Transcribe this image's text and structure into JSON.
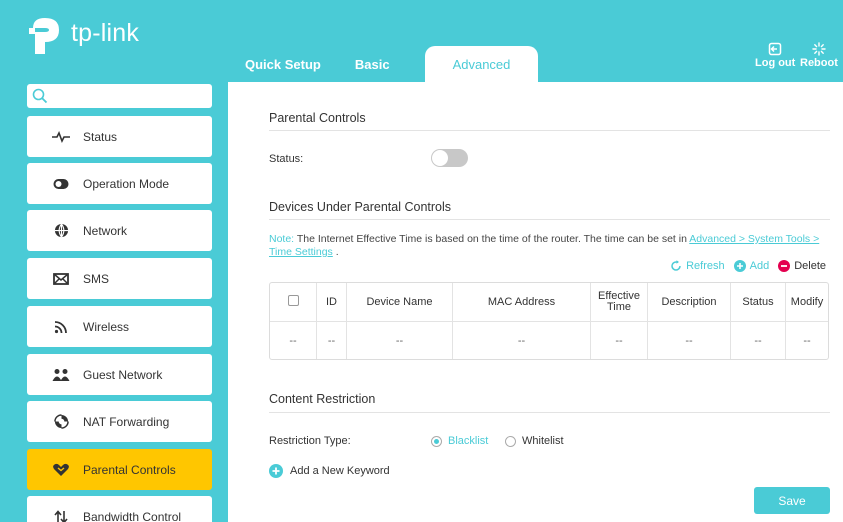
{
  "brand": {
    "logo_text": "tp-link",
    "accent": "#4acbd6",
    "active": "#ffc600"
  },
  "header": {
    "tabs": [
      {
        "label": "Quick Setup"
      },
      {
        "label": "Basic"
      },
      {
        "label": "Advanced"
      }
    ],
    "active_tab": "Advanced",
    "logout_label": "Log out",
    "reboot_label": "Reboot"
  },
  "sidebar": {
    "search_icon": "search-icon",
    "items": [
      {
        "label": "Status",
        "icon": "pulse-icon"
      },
      {
        "label": "Operation Mode",
        "icon": "toggle-icon"
      },
      {
        "label": "Network",
        "icon": "globe-icon"
      },
      {
        "label": "SMS",
        "icon": "envelope-icon"
      },
      {
        "label": "Wireless",
        "icon": "wifi-icon"
      },
      {
        "label": "Guest Network",
        "icon": "guests-icon"
      },
      {
        "label": "NAT Forwarding",
        "icon": "nat-icon"
      },
      {
        "label": "Parental Controls",
        "icon": "heart-shield-icon"
      },
      {
        "label": "Bandwidth Control",
        "icon": "updown-arrows-icon"
      }
    ],
    "active_item": "Parental Controls"
  },
  "parental": {
    "title": "Parental Controls",
    "status_label": "Status:",
    "status_on": false
  },
  "devices": {
    "title": "Devices Under Parental Controls",
    "note_prefix": "Note:",
    "note_text": "The Internet Effective Time is based on the time of the router. The time can be set in",
    "note_link": "Advanced > System Tools > Time Settings",
    "note_end": ".",
    "refresh_label": "Refresh",
    "add_label": "Add",
    "delete_label": "Delete",
    "columns": [
      "ID",
      "Device Name",
      "MAC Address",
      "Effective Time",
      "Description",
      "Status",
      "Modify"
    ],
    "rows": [
      [
        "--",
        "--",
        "--",
        "--",
        "--",
        "--",
        "--",
        "--"
      ]
    ]
  },
  "content": {
    "title": "Content Restriction",
    "restriction_label": "Restriction Type:",
    "blacklist_label": "Blacklist",
    "whitelist_label": "Whitelist",
    "selected": "Blacklist",
    "add_keyword_label": "Add a New Keyword",
    "save_label": "Save"
  }
}
